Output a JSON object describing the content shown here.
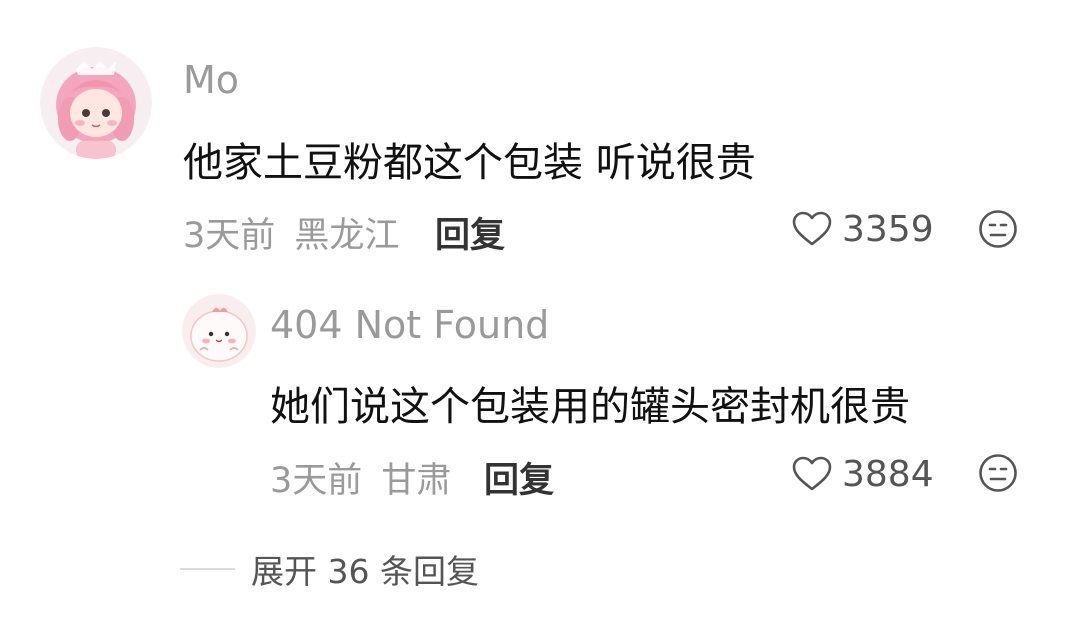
{
  "comments": [
    {
      "username": "Mo",
      "content": "他家土豆粉都这个包装 听说很贵",
      "time": "3天前",
      "location": "黑龙江",
      "reply_label": "回复",
      "likes": "3359"
    },
    {
      "username": "404 Not Found",
      "content": "她们说这个包装用的罐头密封机很贵",
      "time": "3天前",
      "location": "甘肃",
      "reply_label": "回复",
      "likes": "3884"
    }
  ],
  "expand_label": "展开 36 条回复",
  "colors": {
    "meta_gray": "#9a9a9a",
    "content_black": "#111111",
    "avatar_pink": "#f4a7b9"
  },
  "icons": [
    "avatar-pink-character",
    "avatar-cute-blob",
    "heart-icon",
    "dislike-face-icon"
  ]
}
